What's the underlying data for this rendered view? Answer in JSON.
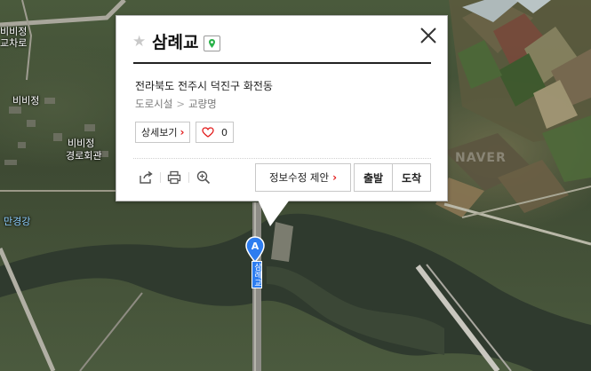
{
  "map": {
    "labels": {
      "top_left_1": "비비정",
      "top_left_2": "교차로",
      "village": "비비정",
      "hall_1": "비비정",
      "hall_2": "경로회관",
      "river": "만경강"
    },
    "watermark": "NAVER",
    "marker_letter": "A",
    "marker_label": "삼례교"
  },
  "popup": {
    "title": "삼례교",
    "star_icon": "star-icon",
    "address": "전라북도 전주시 덕진구 화전동",
    "category_main": "도로시설",
    "category_sub": "교량명",
    "detail_button": "상세보기",
    "like_count": "0",
    "suggest_edit_button": "정보수정 제안",
    "depart_button": "출발",
    "arrive_button": "도착",
    "colors": {
      "accent": "#e21b1b",
      "marker": "#2d7df0"
    }
  }
}
